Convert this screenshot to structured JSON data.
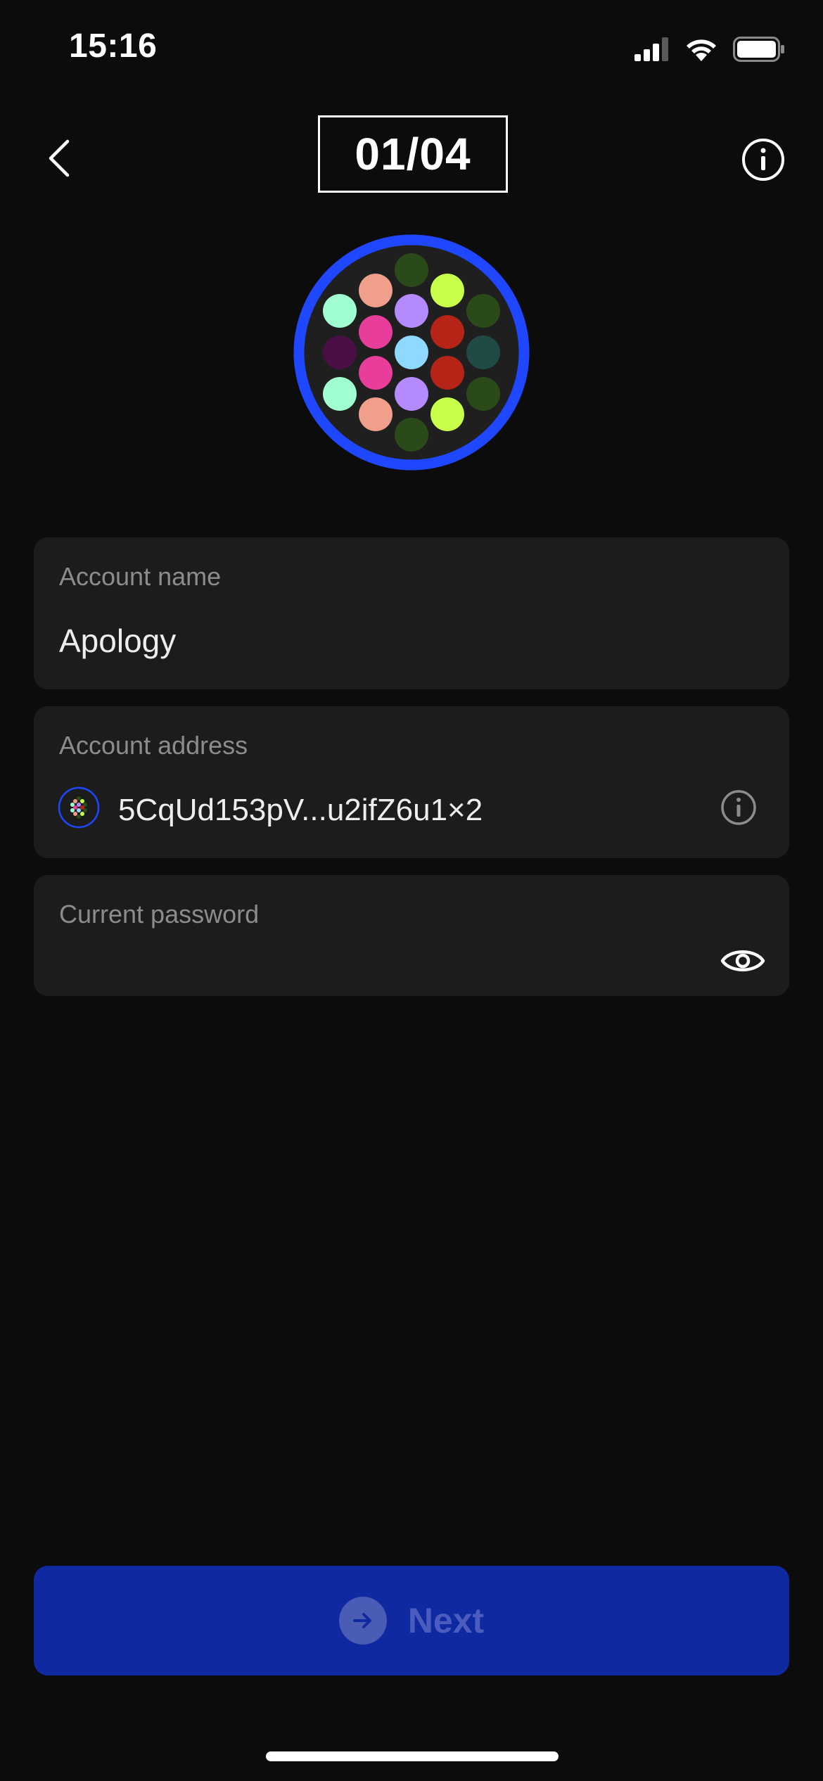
{
  "status_bar": {
    "time": "15:16",
    "icons": [
      "signal-icon",
      "wifi-icon",
      "battery-icon"
    ]
  },
  "header": {
    "step": "01/04",
    "back_icon": "chevron-left-icon",
    "info_icon": "info-circle-icon"
  },
  "avatar": {
    "ring_color": "#1f47ff",
    "dot_colors": [
      "#2b4a1a",
      "#f0a08a",
      "#c8ff4a",
      "#9fffd0",
      "#b48aff",
      "#2b4a1a",
      "#e83d9a",
      "#b62418",
      "#4a0f45",
      "#8fd8ff",
      "#1f4a46"
    ]
  },
  "form": {
    "account_name": {
      "label": "Account name",
      "value": "Apology"
    },
    "account_address": {
      "label": "Account address",
      "value": "5CqUd153pV...u2ifZ6u1×2",
      "info_icon": "info-circle-icon"
    },
    "current_password": {
      "label": "Current password",
      "value": "",
      "toggle_icon": "eye-icon"
    }
  },
  "actions": {
    "next_label": "Next",
    "next_icon": "arrow-right-circle-icon",
    "primary_color": "#0f2aa0"
  }
}
